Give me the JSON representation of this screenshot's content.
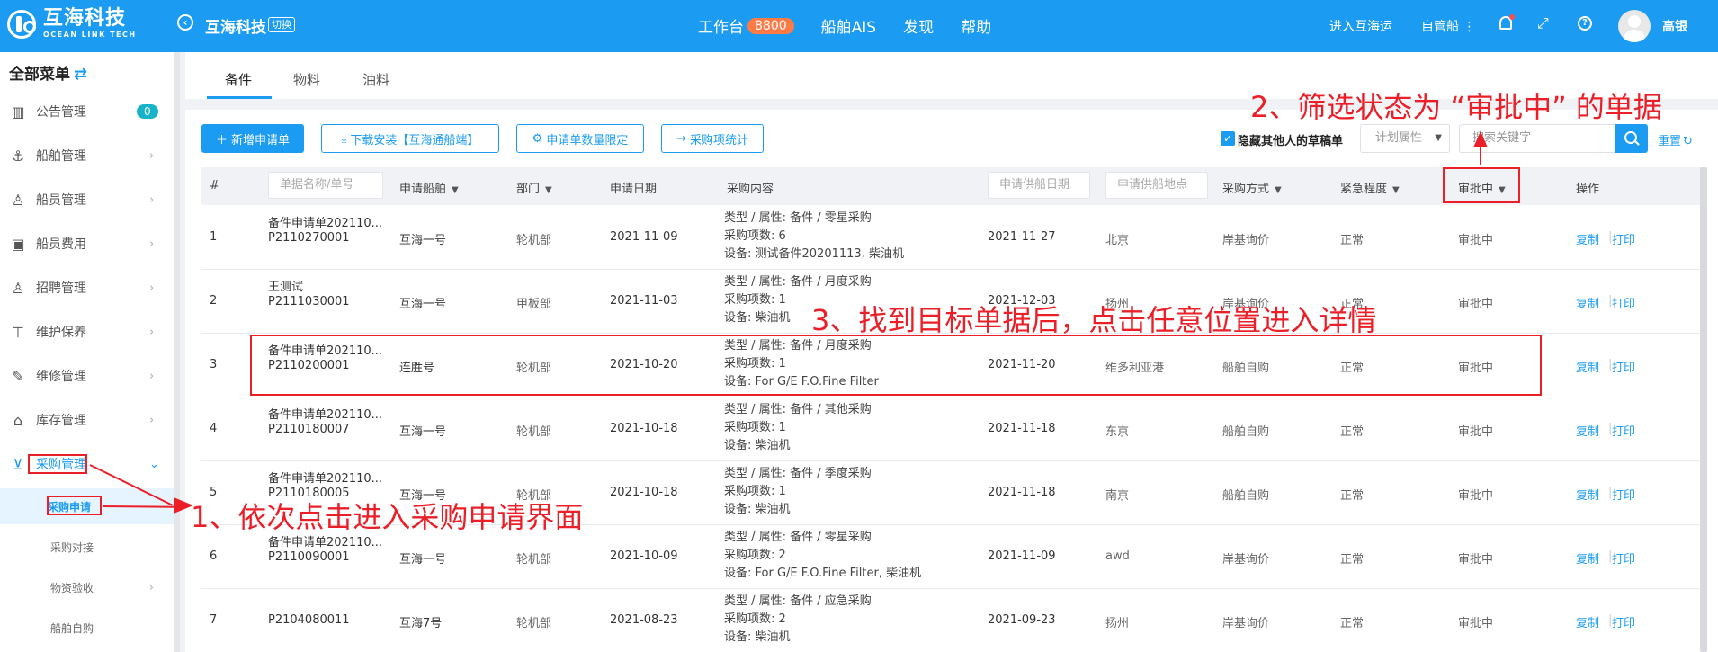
{
  "brand": {
    "name_cn": "互海科技",
    "name_en": "OCEAN LINK TECH"
  },
  "header": {
    "company": "互海科技",
    "switch_label": "切换",
    "nav": {
      "workbench": "工作台",
      "workbench_count": "8800",
      "ais": "船舶AIS",
      "discover": "发现",
      "help": "帮助"
    },
    "enter_link": "进入互海运",
    "self_ship": "自管船",
    "username": "高银"
  },
  "sidebar": {
    "title": "全部菜单",
    "items": [
      {
        "label": "公告管理",
        "badge": "0"
      },
      {
        "label": "船舶管理"
      },
      {
        "label": "船员管理"
      },
      {
        "label": "船员费用"
      },
      {
        "label": "招聘管理"
      },
      {
        "label": "维护保养"
      },
      {
        "label": "维修管理"
      },
      {
        "label": "库存管理"
      },
      {
        "label": "采购管理"
      }
    ],
    "subitems": [
      {
        "label": "采购申请"
      },
      {
        "label": "采购对接"
      },
      {
        "label": "物资验收"
      },
      {
        "label": "船舶自购"
      }
    ]
  },
  "tabs": [
    {
      "label": "备件"
    },
    {
      "label": "物料"
    },
    {
      "label": "油料"
    }
  ],
  "toolbar": {
    "new_btn": "新增申请单",
    "download_btn": "下载安装【互海通船端】",
    "limit_btn": "申请单数量限定",
    "stats_btn": "采购项统计",
    "hide_drafts": "隐藏其他人的草稿单",
    "plan_select": "计划属性",
    "search_placeholder": "搜索关键字",
    "reset": "重置"
  },
  "table": {
    "headers": {
      "num": "#",
      "name_placeholder": "单据名称/单号",
      "ship": "申请船舶",
      "dept": "部门",
      "date": "申请日期",
      "content": "采购内容",
      "supply_date_placeholder": "申请供船日期",
      "supply_place_placeholder": "申请供船地点",
      "method": "采购方式",
      "urgency": "紧急程度",
      "status": "审批中",
      "ops": "操作"
    },
    "rows": [
      {
        "num": "1",
        "name": "备件申请单202110...",
        "code": "P2110270001",
        "ship": "互海一号",
        "dept": "轮机部",
        "date": "2021-11-09",
        "c1": "类型 / 属性:  备件 / 零星采购",
        "c2": "采购项数:  6",
        "c3": "设备:   测试备件20201113, 柴油机",
        "supply_date": "2021-11-27",
        "place": "北京",
        "method": "岸基询价",
        "urgency": "正常",
        "status": "审批中",
        "op1": "复制",
        "op2": "打印"
      },
      {
        "num": "2",
        "name": "王测试",
        "code": "P2111030001",
        "ship": "互海一号",
        "dept": "甲板部",
        "date": "2021-11-03",
        "c1": "类型 / 属性:  备件 / 月度采购",
        "c2": "采购项数:  1",
        "c3": "设备:   柴油机",
        "supply_date": "2021-12-03",
        "place": "扬州",
        "method": "岸基询价",
        "urgency": "正常",
        "status": "审批中",
        "op1": "复制",
        "op2": "打印"
      },
      {
        "num": "3",
        "name": "备件申请单202110...",
        "code": "P2110200001",
        "ship": "连胜号",
        "dept": "轮机部",
        "date": "2021-10-20",
        "c1": "类型 / 属性:  备件 / 月度采购",
        "c2": "采购项数:  1",
        "c3": "设备:   For G/E F.O.Fine Filter",
        "supply_date": "2021-11-20",
        "place": "维多利亚港",
        "method": "船舶自购",
        "urgency": "正常",
        "status": "审批中",
        "op1": "复制",
        "op2": "打印"
      },
      {
        "num": "4",
        "name": "备件申请单202110...",
        "code": "P2110180007",
        "ship": "互海一号",
        "dept": "轮机部",
        "date": "2021-10-18",
        "c1": "类型 / 属性:  备件 / 其他采购",
        "c2": "采购项数:  1",
        "c3": "设备:   柴油机",
        "supply_date": "2021-11-18",
        "place": "东京",
        "method": "船舶自购",
        "urgency": "正常",
        "status": "审批中",
        "op1": "复制",
        "op2": "打印"
      },
      {
        "num": "5",
        "name": "备件申请单202110...",
        "code": "P2110180005",
        "ship": "互海一号",
        "dept": "轮机部",
        "date": "2021-10-18",
        "c1": "类型 / 属性:  备件 / 季度采购",
        "c2": "采购项数:  1",
        "c3": "设备:   柴油机",
        "supply_date": "2021-11-18",
        "place": "南京",
        "method": "船舶自购",
        "urgency": "正常",
        "status": "审批中",
        "op1": "复制",
        "op2": "打印"
      },
      {
        "num": "6",
        "name": "备件申请单202110...",
        "code": "P2110090001",
        "ship": "互海一号",
        "dept": "轮机部",
        "date": "2021-10-09",
        "c1": "类型 / 属性:  备件 / 零星采购",
        "c2": "采购项数:  2",
        "c3": "设备:   For G/E F.O.Fine Filter, 柴油机",
        "supply_date": "2021-11-09",
        "place": "awd",
        "method": "岸基询价",
        "urgency": "正常",
        "status": "审批中",
        "op1": "复制",
        "op2": "打印"
      },
      {
        "num": "7",
        "name": "",
        "code": "P2104080011",
        "ship": "互海7号",
        "dept": "轮机部",
        "date": "2021-08-23",
        "c1": "类型 / 属性:  备件 / 应急采购",
        "c2": "采购项数:  2",
        "c3": "设备:   柴油机",
        "supply_date": "2021-09-23",
        "place": "扬州",
        "method": "岸基询价",
        "urgency": "正常",
        "status": "审批中",
        "op1": "复制",
        "op2": "打印"
      }
    ]
  },
  "annotations": {
    "step1": "1、依次点击进入采购申请界面",
    "step2": "2、筛选状态为 “审批中” 的单据",
    "step3": "3、找到目标单据后，点击任意位置进入详情",
    "color": "#ea1f28"
  }
}
